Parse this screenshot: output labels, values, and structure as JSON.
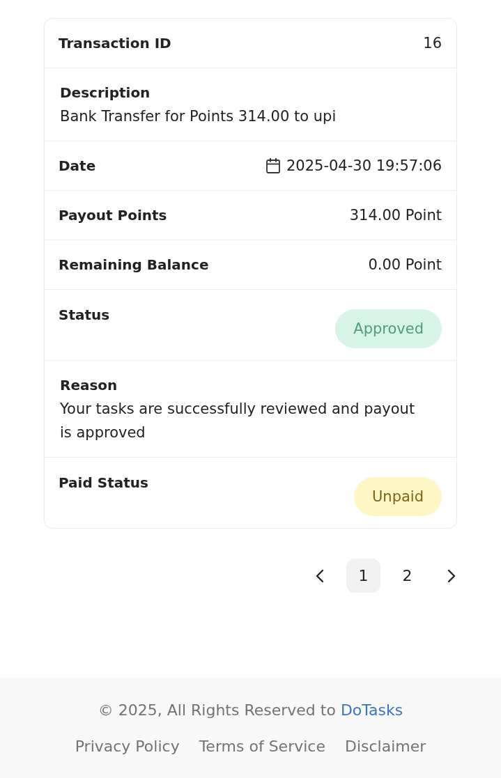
{
  "details": {
    "rows": [
      {
        "kind": "inline",
        "label": "Transaction ID",
        "value": "16"
      },
      {
        "kind": "stacked",
        "label": "Description",
        "value": "Bank Transfer for Points 314.00 to upi"
      },
      {
        "kind": "date",
        "label": "Date",
        "value": "2025-04-30 19:57:06"
      },
      {
        "kind": "inline",
        "label": "Payout Points",
        "value": "314.00 Point"
      },
      {
        "kind": "inline",
        "label": "Remaining Balance",
        "value": "0.00 Point"
      },
      {
        "kind": "badge",
        "label": "Status",
        "value": "Approved",
        "color": "#4f9d7c"
      },
      {
        "kind": "stacked",
        "label": "Reason",
        "value": "Your tasks are successfully reviewed and payout is approved"
      },
      {
        "kind": "badge",
        "label": "Paid Status",
        "value": "Unpaid",
        "color": "#7d6518"
      }
    ]
  },
  "pagination": {
    "items": [
      {
        "kind": "prev"
      },
      {
        "kind": "page",
        "label": "1",
        "selected": true
      },
      {
        "kind": "page",
        "label": "2",
        "selected": false
      },
      {
        "kind": "next"
      }
    ]
  },
  "footer": {
    "copyright": {
      "text": "© 2025, All Rights Reserved to",
      "link": "DoTasks"
    },
    "links": [
      "Privacy Policy",
      "Terms of Service",
      "Disclaimer"
    ]
  }
}
